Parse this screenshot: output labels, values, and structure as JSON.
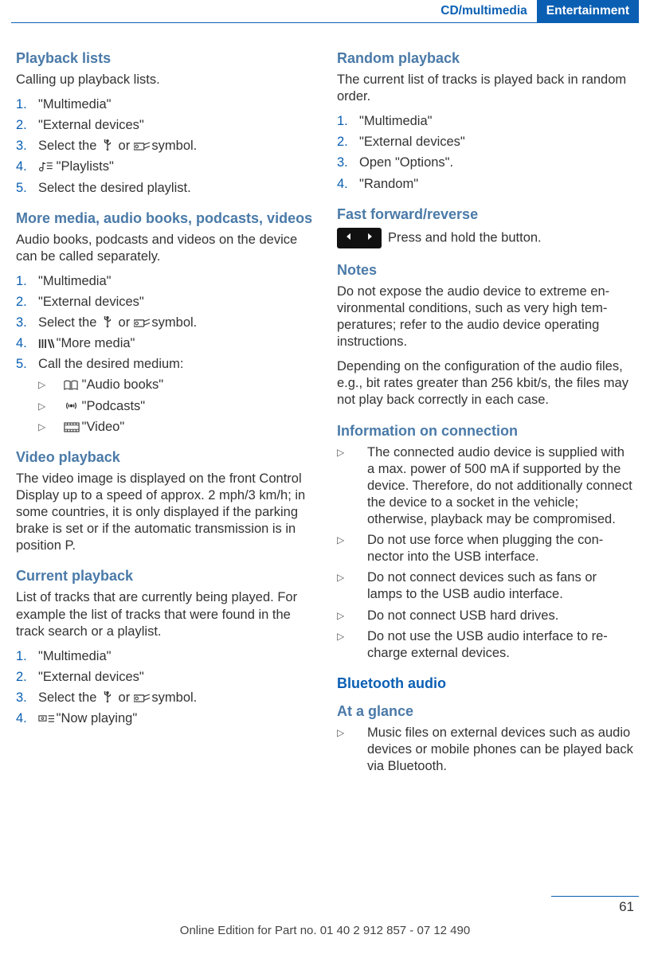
{
  "header": {
    "tab_inactive": "CD/multimedia",
    "tab_active": "Entertainment"
  },
  "left": {
    "playbackLists": {
      "title": "Playback lists",
      "desc": "Calling up playback lists.",
      "steps": [
        "\"Multimedia\"",
        "\"External devices\"",
        "Select the   or   symbol.",
        " \"Playlists\"",
        "Select the desired playlist."
      ],
      "step3_pre": "Select the ",
      "step3_mid": " or ",
      "step3_post": " symbol.",
      "step4_text": " \"Playlists\""
    },
    "moreMedia": {
      "title": "More media, audio books, podcasts, videos",
      "desc": "Audio books, podcasts and videos on the device can be called separately.",
      "steps": {
        "s1": "\"Multimedia\"",
        "s2": "\"External devices\"",
        "s3_pre": "Select the ",
        "s3_mid": " or ",
        "s3_post": " symbol.",
        "s4_text": " \"More media\"",
        "s5": "Call the desired medium:"
      },
      "subs": {
        "a": " \"Audio books\"",
        "b": " \"Podcasts\"",
        "c": " \"Video\""
      }
    },
    "videoPlayback": {
      "title": "Video playback",
      "desc": "The video image is displayed on the front Con­trol Display up to a speed of approx. 2 mph/3 km/h; in some countries, it is only dis­played if the parking brake is set or if the auto­matic transmission is in position P."
    },
    "currentPlayback": {
      "title": "Current playback",
      "desc": "List of tracks that are currently being played. For example the list of tracks that were found in the track search or a playlist.",
      "steps": {
        "s1": "\"Multimedia\"",
        "s2": "\"External devices\"",
        "s3_pre": "Select the ",
        "s3_mid": " or ",
        "s3_post": " symbol.",
        "s4_text": " \"Now playing\""
      }
    }
  },
  "right": {
    "randomPlayback": {
      "title": "Random playback",
      "desc": "The current list of tracks is played back in ran­dom order.",
      "steps": {
        "s1": "\"Multimedia\"",
        "s2": "\"External devices\"",
        "s3": "Open \"Options\".",
        "s4": "\"Random\""
      }
    },
    "fastForward": {
      "title": "Fast forward/reverse",
      "desc": "Press and hold the button."
    },
    "notes": {
      "title": "Notes",
      "p1": "Do not expose the audio device to extreme en­vironmental conditions, such as very high tem­peratures; refer to the audio device operating instructions.",
      "p2": "Depending on the configuration of the audio files, e.g., bit rates greater than 256 kbit/s, the files may not play back correctly in each case."
    },
    "infoConn": {
      "title": "Information on connection",
      "items": {
        "a": "The connected audio device is supplied with a max. power of 500 mA if supported by the device. Therefore, do not additionally con­nect the device to a socket in the vehicle; otherwise, playback may be compromised.",
        "b": "Do not use force when plugging the con­nector into the USB interface.",
        "c": "Do not connect devices such as fans or lamps to the USB audio interface.",
        "d": "Do not connect USB hard drives.",
        "e": "Do not use the USB audio interface to re­charge external devices."
      }
    },
    "bluetooth": {
      "title": "Bluetooth audio",
      "atAGlance": "At a glance",
      "item": "Music files on external devices such as audio devices or mobile phones can be played back via Bluetooth."
    }
  },
  "footer": "Online Edition for Part no. 01 40 2 912 857 - 07 12 490",
  "pageNumber": "61"
}
